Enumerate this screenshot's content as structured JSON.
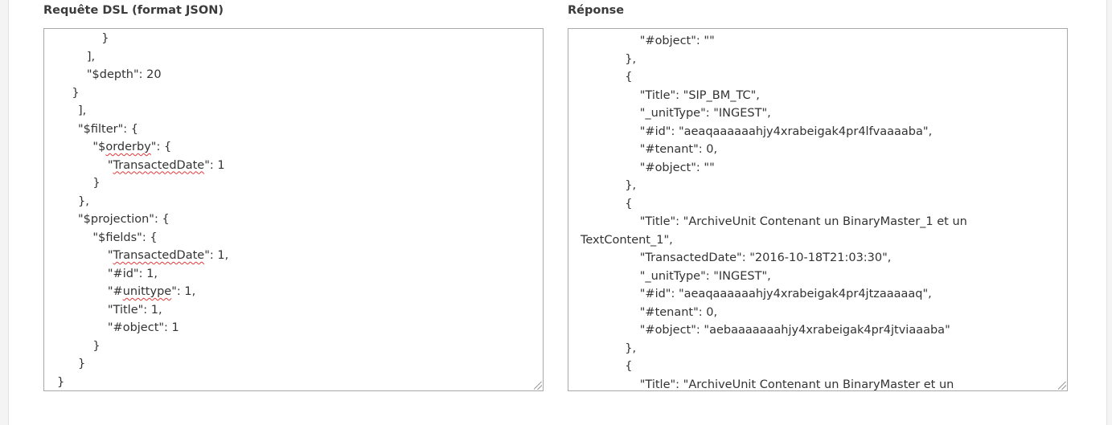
{
  "request_panel": {
    "label": "Requête DSL (format JSON)",
    "lines": [
      "            }",
      "        ],",
      "        \"$depth\": 20",
      "    }",
      "],",
      "\"$filter\": {",
      "    \"$orderby\": {",
      "        \"TransactedDate\": 1",
      "    }",
      "},",
      "\"$projection\": {",
      "    \"$fields\": {",
      "        \"TransactedDate\": 1,",
      "        \"#id\": 1,",
      "        \"#unittype\": 1,",
      "        \"Title\": 1,",
      "        \"#object\": 1",
      "    }",
      "}"
    ],
    "closing_line": "}"
  },
  "response_panel": {
    "label": "Réponse",
    "lines": [
      "                \"#object\": \"\"",
      "            },",
      "            {",
      "                \"Title\": \"SIP_BM_TC\",",
      "                \"_unitType\": \"INGEST\",",
      "                \"#id\": \"aeaqaaaaaahjy4xrabeigak4pr4lfvaaaaba\",",
      "                \"#tenant\": 0,",
      "                \"#object\": \"\"",
      "            },",
      "            {",
      "                \"Title\": \"ArchiveUnit Contenant un BinaryMaster_1 et un",
      "TextContent_1\",",
      "                \"TransactedDate\": \"2016-10-18T21:03:30\",",
      "                \"_unitType\": \"INGEST\",",
      "                \"#id\": \"aeaqaaaaaahjy4xrabeigak4pr4jtzaaaaaq\",",
      "                \"#tenant\": 0,",
      "                \"#object\": \"aebaaaaaaahjy4xrabeigak4pr4jtviaaaba\"",
      "            },",
      "            {",
      "                \"Title\": \"ArchiveUnit Contenant un BinaryMaster et un"
    ]
  }
}
